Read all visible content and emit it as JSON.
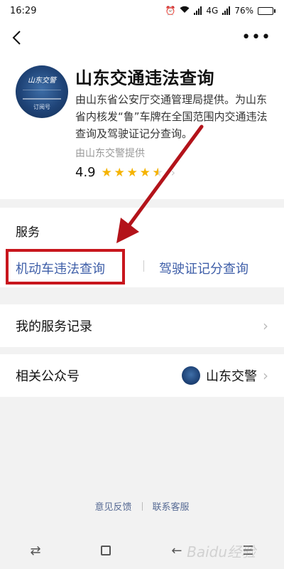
{
  "status": {
    "time": "16:29",
    "network": "4G",
    "battery": "76%",
    "battery_level": 0.76
  },
  "header": {
    "back_icon": "chevron-left-icon",
    "more_icon": "more-dots-icon",
    "more_text": "•••"
  },
  "account": {
    "logo_text": "山东交警",
    "logo_badge": "订阅号",
    "title": "山东交通违法查询",
    "description": "由山东省公安厅交通管理局提供。为山东省内核发“鲁”车牌在全国范围内交通违法查询及驾驶证记分查询。",
    "provider": "由山东交警提供",
    "rating": "4.9",
    "stars_value": 4.5,
    "star_color": "#f5b300"
  },
  "services": {
    "heading": "服务",
    "items": [
      {
        "label": "机动车违法查询"
      },
      {
        "label": "驾驶证记分查询"
      }
    ],
    "link_color": "#3e5ea8",
    "highlight_color": "#c8161d"
  },
  "rows": {
    "records": "我的服务记录",
    "related": "相关公众号",
    "related_account": "山东交警"
  },
  "footer": {
    "feedback": "意见反馈",
    "support": "联系客服"
  },
  "watermark": "Baidu经验"
}
